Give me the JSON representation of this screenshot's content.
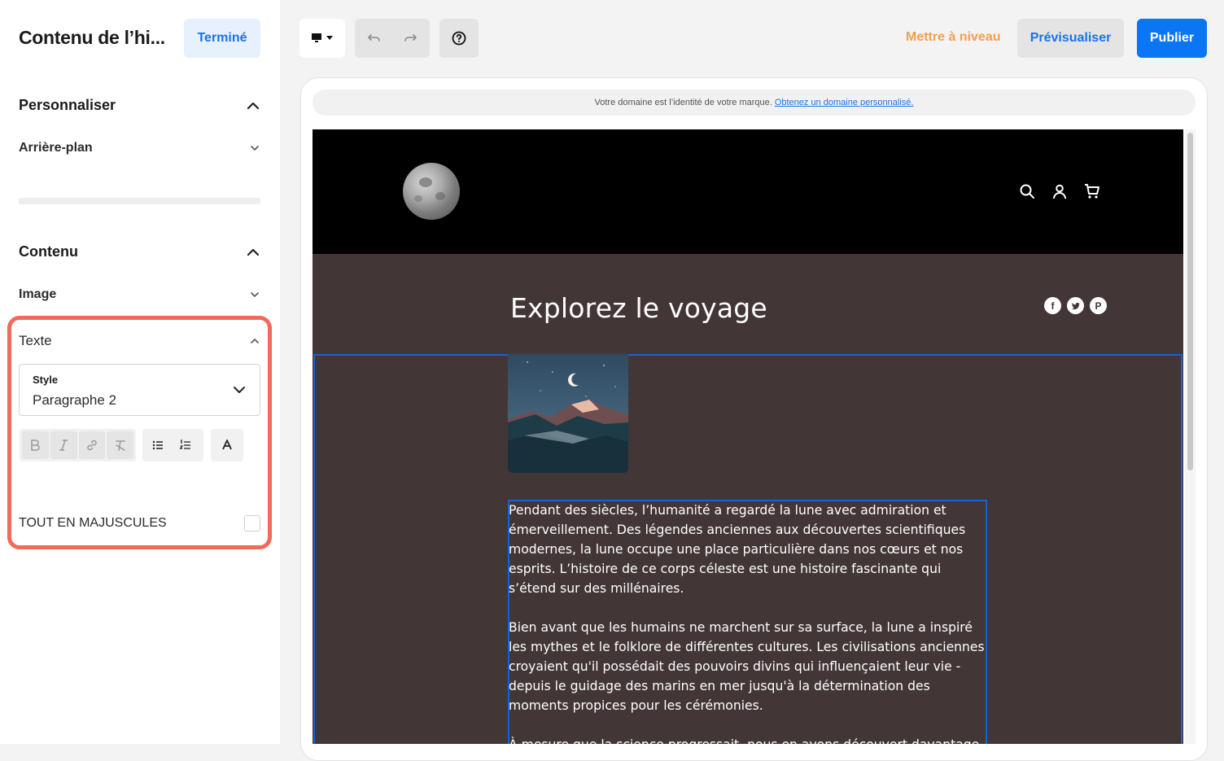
{
  "sidebar": {
    "title": "Contenu de l’hi...",
    "done_label": "Terminé",
    "sections": {
      "personalize": {
        "heading": "Personnaliser",
        "background_label": "Arrière-plan"
      },
      "content": {
        "heading": "Contenu",
        "image_label": "Image",
        "text_label": "Texte"
      }
    },
    "style": {
      "label": "Style",
      "value": "Paragraphe 2"
    },
    "formatting": [
      "bold-icon",
      "italic-icon",
      "link-icon",
      "clear-format-icon",
      "bullet-list-icon",
      "numbered-list-icon",
      "text-color-icon"
    ],
    "caps_label": "TOUT EN MAJUSCULES",
    "caps_checked": false
  },
  "toolbar": {
    "device_icon": "desktop-icon",
    "upgrade_label": "Mettre à niveau",
    "preview_label": "Prévisualiser",
    "publish_label": "Publier"
  },
  "domain_banner": {
    "text": "Votre domaine est l’identité de votre marque.",
    "link": "Obtenez un domaine personnalisé."
  },
  "site": {
    "title": "Explorez le voyage",
    "social": [
      "facebook-icon",
      "twitter-icon",
      "pinterest-icon"
    ],
    "paragraphs": [
      "Pendant des siècles, l’humanité a regardé la lune avec admiration et émerveillement. Des légendes anciennes aux découvertes scientifiques modernes, la lune occupe une place particulière dans nos cœurs et nos esprits. L’histoire de ce corps céleste est une histoire fascinante qui s’étend sur des millénaires.",
      "Bien avant que les humains ne marchent sur sa surface, la lune a inspiré les mythes et le folklore de différentes cultures. Les civilisations anciennes croyaient qu'il possédait des pouvoirs divins qui influençaient leur vie - depuis le guidage des marins en mer jusqu'à la détermination des moments propices pour les cérémonies.",
      "À mesure que la science progressait, nous en avons découvert davantage sur"
    ]
  },
  "colors": {
    "accent": "#1a73e8",
    "publish": "#0b76f4",
    "upgrade": "#f5a04b",
    "highlight": "#f16a5a",
    "site_bg": "#433637"
  }
}
